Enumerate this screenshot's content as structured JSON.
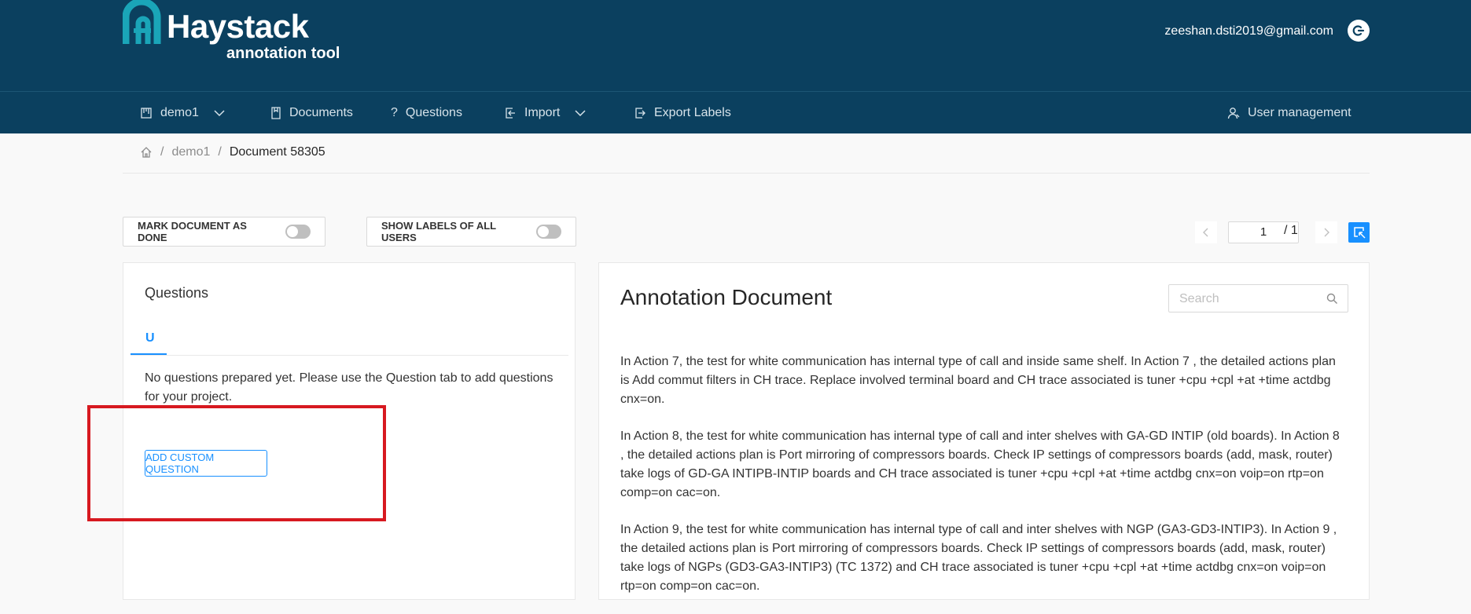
{
  "app": {
    "logo_text": "Haystack",
    "logo_subtitle": "annotation tool",
    "user_email": "zeeshan.dsti2019@gmail.com"
  },
  "nav": {
    "project": "demo1",
    "documents": "Documents",
    "questions": "Questions",
    "import": "Import",
    "export": "Export Labels",
    "user_management": "User management"
  },
  "breadcrumb": {
    "project": "demo1",
    "separator": "/",
    "document": "Document 58305"
  },
  "toolbar": {
    "mark_done": "MARK DOCUMENT AS DONE",
    "show_labels": "SHOW LABELS OF ALL USERS",
    "mark_done_on": false,
    "show_labels_on": false
  },
  "pager": {
    "current": "1",
    "total": "/ 1"
  },
  "questions_panel": {
    "title": "Questions",
    "tab": "U",
    "empty_message": "No questions prepared yet. Please use the Question tab to add questions for your project.",
    "add_button": "ADD CUSTOM QUESTION"
  },
  "document_panel": {
    "title": "Annotation Document",
    "search_placeholder": "Search",
    "paragraphs": [
      "In Action 7, the test for white communication has internal type of call and inside same shelf. In Action 7 , the detailed actions plan is Add commut filters in CH trace. Replace involved terminal board and CH trace associated is tuner +cpu +cpl +at +time actdbg cnx=on.",
      "In Action 8, the test for white communication has internal type of call and inter shelves with GA-GD INTIP (old boards). In Action 8 , the detailed actions plan is Port mirroring of compressors boards. Check IP settings of compressors boards (add, mask, router) take logs of GD-GA INTIPB-INTIP boards and CH trace associated is tuner +cpu +cpl +at +time actdbg cnx=on voip=on rtp=on comp=on cac=on.",
      "In Action 9, the test for white communication has internal type of call and inter shelves with NGP (GA3-GD3-INTIP3). In Action 9 , the detailed actions plan is Port mirroring of compressors boards. Check IP settings of compressors boards (add, mask, router) take logs of NGPs (GD3-GA3-INTIP3) (TC 1372) and CH trace associated is tuner +cpu +cpl +at +time actdbg cnx=on voip=on rtp=on comp=on cac=on."
    ]
  },
  "colors": {
    "header_bg": "#0b405f",
    "accent": "#1890ff",
    "highlight": "#d71920"
  }
}
